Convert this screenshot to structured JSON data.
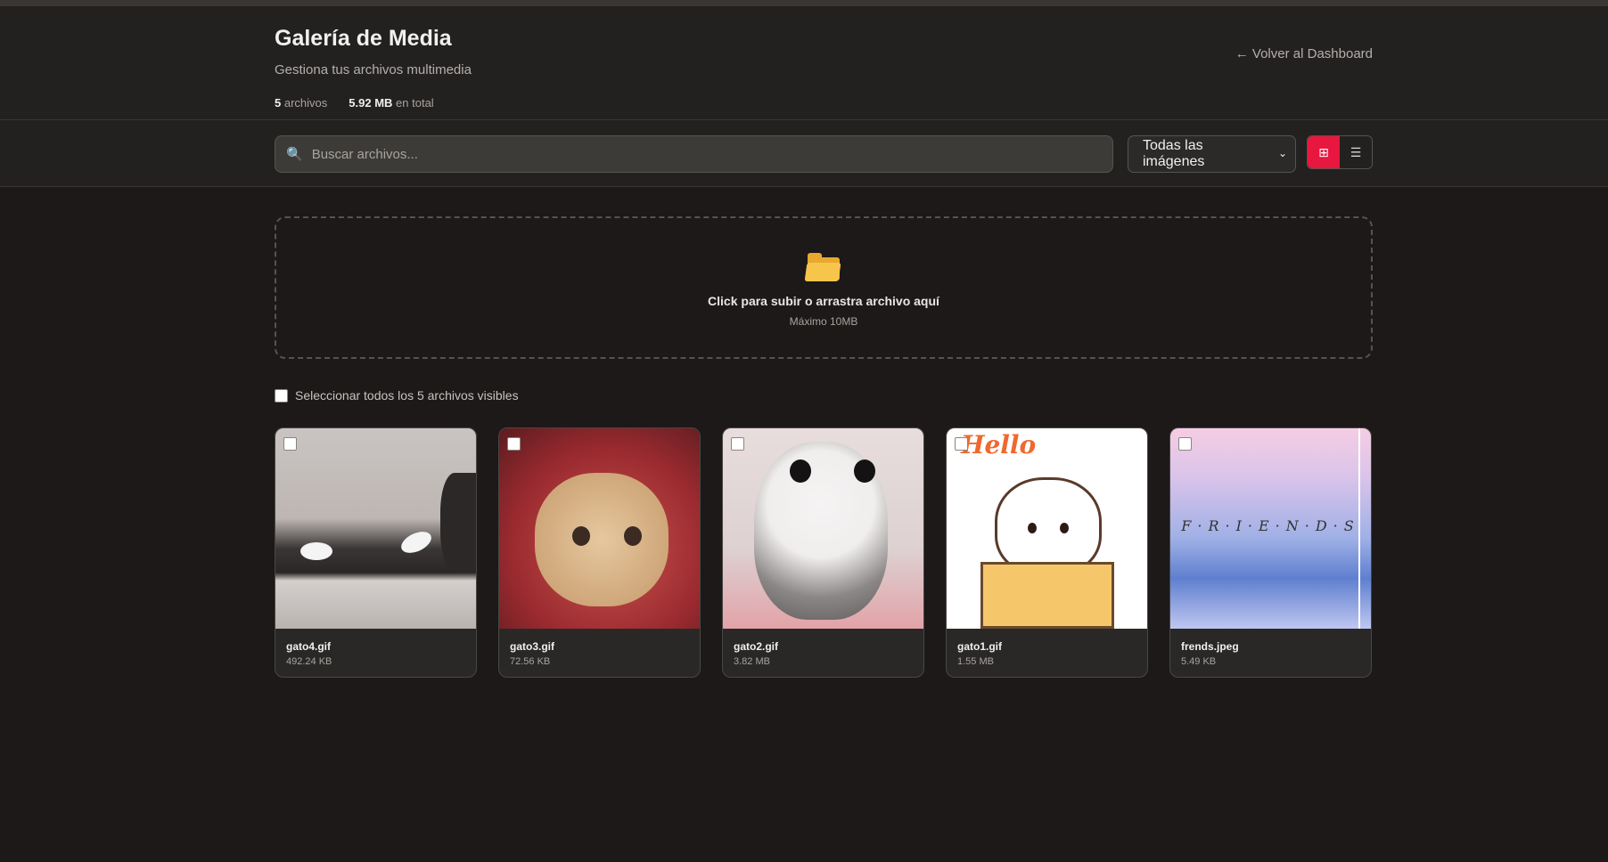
{
  "header": {
    "title": "Galería de Media",
    "subtitle": "Gestiona tus archivos multimedia",
    "stats": {
      "count_value": "5",
      "count_label": "archivos",
      "size_value": "5.92 MB",
      "size_label": "en total"
    },
    "back_link": "← Volver al Dashboard"
  },
  "toolbar": {
    "search_placeholder": "Buscar archivos...",
    "filter_selected": "Todas las imágenes",
    "view_grid_icon": "⊞",
    "view_list_icon": "☰"
  },
  "dropzone": {
    "title": "Click para subir o arrastra archivo aquí",
    "subtitle": "Máximo 10MB"
  },
  "select_all": {
    "label": "Seleccionar todos los 5 archivos visibles"
  },
  "files": [
    {
      "name": "gato4.gif",
      "size": "492.24 KB"
    },
    {
      "name": "gato3.gif",
      "size": "72.56 KB"
    },
    {
      "name": "gato2.gif",
      "size": "3.82 MB"
    },
    {
      "name": "gato1.gif",
      "size": "1.55 MB"
    },
    {
      "name": "frends.jpeg",
      "size": "5.49 KB"
    }
  ],
  "thumb_text": {
    "gato1_overlay": "Hello",
    "frends_overlay": "F·R·I·E·N·D·S"
  },
  "colors": {
    "accent": "#e8173f",
    "background": "#1c1918",
    "header_bg": "#232120"
  },
  "icons": {
    "search": "search-icon",
    "folder": "folder-icon",
    "grid_view": "grid-view-icon",
    "list_view": "list-view-icon"
  }
}
